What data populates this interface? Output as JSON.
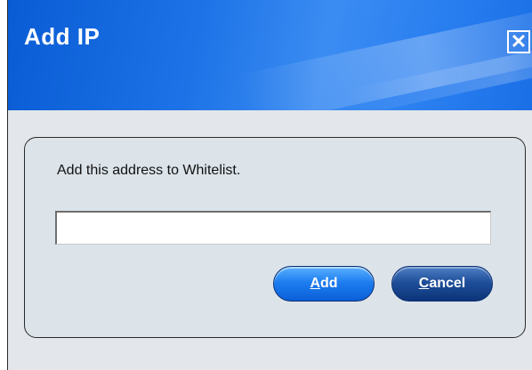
{
  "dialog": {
    "title": "Add IP",
    "close_glyph": "✕",
    "prompt": "Add this address to Whitelist.",
    "ip_input": {
      "value": "",
      "placeholder": ""
    },
    "buttons": {
      "add": {
        "mnemonic": "A",
        "rest": "dd"
      },
      "cancel": {
        "mnemonic": "C",
        "rest": "ancel"
      }
    }
  },
  "colors": {
    "titlebar": "#1c72e6",
    "add_button": "#1e7ef0",
    "cancel_button": "#1f4f9a",
    "panel_bg": "#dce4ea"
  },
  "icons": {
    "close": "close-icon"
  }
}
